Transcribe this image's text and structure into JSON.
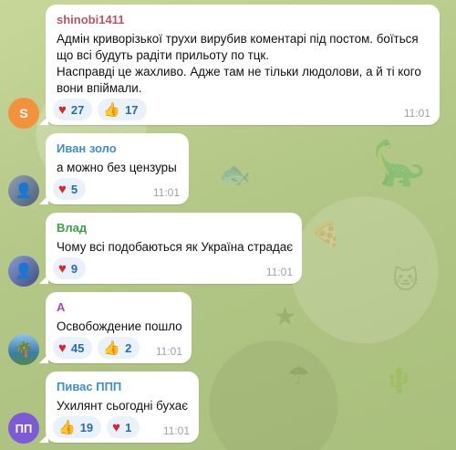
{
  "messages": [
    {
      "sender": "shinobi1411",
      "sender_color": "#b8556b",
      "avatar_letter": "S",
      "avatar_color": "#f2923d",
      "lines": [
        "Адмін криворізької трухи вирубив коментарі під постом. боїться",
        "що всі будуть радіти прильоту по тцк.",
        "Насправді це жахливо. Адже там не тільки людолови, а й ті кого",
        "вони впіймали."
      ],
      "reactions": [
        {
          "icon": "heart-icon",
          "count": "27"
        },
        {
          "icon": "thumbs-up-icon",
          "count": "17"
        }
      ],
      "time": "11:01"
    },
    {
      "sender": "Иван золо",
      "sender_color": "#3d8fc6",
      "avatar_letter": "",
      "avatar_color": "#7a8aa0",
      "lines": [
        "а можно без цензуры"
      ],
      "reactions": [
        {
          "icon": "heart-icon",
          "count": "5"
        }
      ],
      "time": "11:01"
    },
    {
      "sender": "Влад",
      "sender_color": "#3aa04a",
      "avatar_letter": "",
      "avatar_color": "#6d7fae",
      "lines": [
        "Чому всі подобаються як Україна страдає"
      ],
      "reactions": [
        {
          "icon": "heart-icon",
          "count": "9"
        }
      ],
      "time": "11:01"
    },
    {
      "sender": "А",
      "sender_color": "#b0479e",
      "avatar_letter": "",
      "avatar_color": "#5b8fb8",
      "lines": [
        "Освобождение пошло"
      ],
      "reactions": [
        {
          "icon": "heart-icon",
          "count": "45"
        },
        {
          "icon": "thumbs-up-icon",
          "count": "2"
        }
      ],
      "time": "11:01"
    },
    {
      "sender": "Пивас ППП",
      "sender_color": "#3d8fc6",
      "avatar_letter": "ПП",
      "avatar_color": "#7e5bd6",
      "lines": [
        "Ухилянт сьогодні бухає"
      ],
      "reactions": [
        {
          "icon": "thumbs-up-icon",
          "count": "19"
        },
        {
          "icon": "heart-icon",
          "count": "1"
        }
      ],
      "time": "11:01"
    }
  ]
}
